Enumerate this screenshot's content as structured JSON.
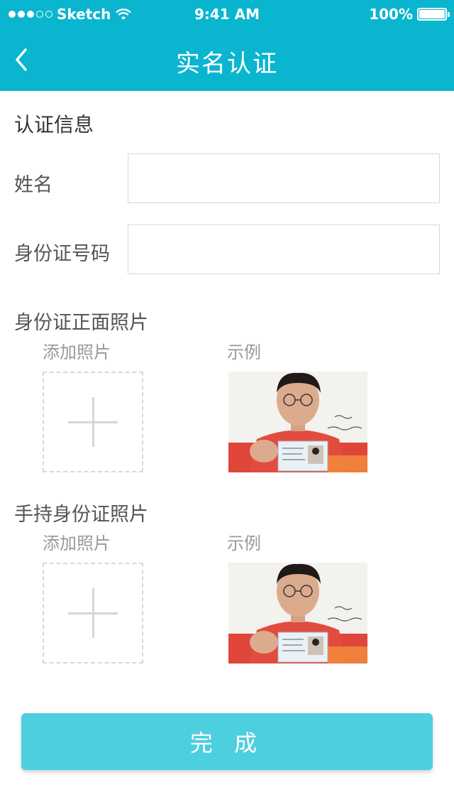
{
  "status_bar": {
    "carrier": "Sketch",
    "time": "9:41 AM",
    "battery": "100%",
    "signal_bars": 3,
    "signal_total": 5
  },
  "nav": {
    "title": "实名认证",
    "back_icon": "chevron-left-icon"
  },
  "form": {
    "section_title": "认证信息",
    "name_label": "姓名",
    "name_value": "",
    "id_label": "身份证号码",
    "id_value": ""
  },
  "id_front": {
    "title": "身份证正面照片",
    "add_label": "添加照片",
    "example_label": "示例",
    "add_icon": "plus-icon"
  },
  "id_handheld": {
    "title": "手持身份证照片",
    "add_label": "添加照片",
    "example_label": "示例",
    "add_icon": "plus-icon"
  },
  "submit_label": "完 成",
  "colors": {
    "primary": "#0ab5cf",
    "button": "#4ecfe0"
  }
}
